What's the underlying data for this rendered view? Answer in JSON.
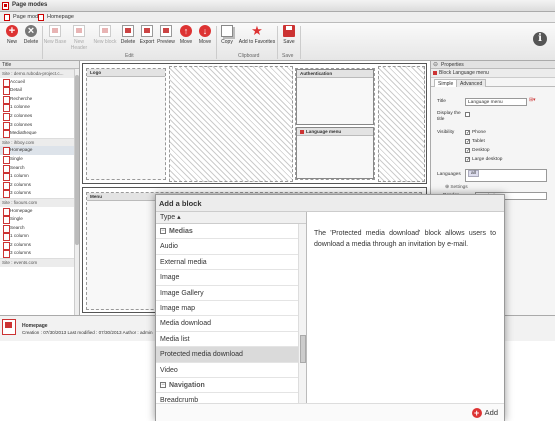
{
  "window": {
    "title": "Page modes"
  },
  "tabs": [
    {
      "label": "Page modes"
    },
    {
      "label": "Homepage"
    }
  ],
  "ribbon": {
    "buttons": [
      {
        "label": "New"
      },
      {
        "label": "Delete"
      },
      {
        "label": "New Base"
      },
      {
        "label": "New Header"
      },
      {
        "label": "New block"
      },
      {
        "label": "Delete"
      },
      {
        "label": "Export"
      },
      {
        "label": "Preview"
      },
      {
        "label": "Move"
      },
      {
        "label": "Move"
      },
      {
        "label": "Copy"
      },
      {
        "label": "Add to Favorites"
      },
      {
        "label": "Save"
      }
    ],
    "groups": {
      "edit": "Edit",
      "clipboard": "Clipboard",
      "save": "Save"
    }
  },
  "tree": {
    "header": "Title",
    "rows": [
      {
        "kind": "site",
        "label": "Site : demo.ruboda-project.c..."
      },
      {
        "kind": "page",
        "label": "Accueil"
      },
      {
        "kind": "page",
        "label": "Detail"
      },
      {
        "kind": "page",
        "label": "Recherche"
      },
      {
        "kind": "page",
        "label": "1 colonne"
      },
      {
        "kind": "page",
        "label": "2 colonnes"
      },
      {
        "kind": "page",
        "label": "3 colonnes"
      },
      {
        "kind": "page",
        "label": "Mediatheque"
      },
      {
        "kind": "site",
        "label": "Site : ihboy.com"
      },
      {
        "kind": "page",
        "label": "Homepage",
        "selected": true
      },
      {
        "kind": "page",
        "label": "Single"
      },
      {
        "kind": "page",
        "label": "Search"
      },
      {
        "kind": "page",
        "label": "1 column"
      },
      {
        "kind": "page",
        "label": "2 columns"
      },
      {
        "kind": "page",
        "label": "3 columns"
      },
      {
        "kind": "site",
        "label": "Site : fixours.com"
      },
      {
        "kind": "page",
        "label": "Homepage"
      },
      {
        "kind": "page",
        "label": "Single"
      },
      {
        "kind": "page",
        "label": "Search"
      },
      {
        "kind": "page",
        "label": "1 column"
      },
      {
        "kind": "page",
        "label": "2 columns"
      },
      {
        "kind": "page",
        "label": "3 columns"
      },
      {
        "kind": "site",
        "label": "Site : events.com"
      }
    ]
  },
  "canvas": {
    "zones": {
      "logo": "Logo",
      "authentication": "Authentication",
      "language_menu": "Language menu",
      "menu": "Menu"
    }
  },
  "properties": {
    "header": "Properties",
    "block_title": "Block Language menu",
    "tabs": [
      "Simple",
      "Advanced"
    ],
    "title_label": "Title",
    "title_value": "Language menu",
    "display_title_label": "Display the title",
    "visibility_label": "Visibility",
    "visibility_options": [
      {
        "label": "Phone",
        "checked": true
      },
      {
        "label": "Tablet",
        "checked": true
      },
      {
        "label": "Desktop",
        "checked": true
      },
      {
        "label": "Large desktop",
        "checked": true
      }
    ],
    "languages_label": "Languages",
    "languages_value": "all",
    "settings_label": "Settings",
    "render_label": "Render",
    "render_value": "Combobox"
  },
  "status": {
    "title": "Homepage",
    "meta": "Creation : 07/30/2013  Last modified : 07/30/2013  Author : admin"
  },
  "dialog": {
    "title": "Add a block",
    "column_header": "Type",
    "items": [
      {
        "kind": "group",
        "label": "Medias"
      },
      {
        "kind": "item",
        "label": "Audio"
      },
      {
        "kind": "item",
        "label": "External media"
      },
      {
        "kind": "item",
        "label": "Image"
      },
      {
        "kind": "item",
        "label": "Image Gallery"
      },
      {
        "kind": "item",
        "label": "Image map"
      },
      {
        "kind": "item",
        "label": "Media download"
      },
      {
        "kind": "item",
        "label": "Media list"
      },
      {
        "kind": "item",
        "label": "Protected media download",
        "selected": true
      },
      {
        "kind": "item",
        "label": "Video"
      },
      {
        "kind": "group",
        "label": "Navigation"
      },
      {
        "kind": "item",
        "label": "Breadcrumb"
      }
    ],
    "description": "The 'Protected media download' block allows users to download a media through an invitation by e-mail.",
    "add_label": "Add"
  },
  "colors": {
    "accent": "#d33333",
    "selected_row": "#dadada"
  }
}
